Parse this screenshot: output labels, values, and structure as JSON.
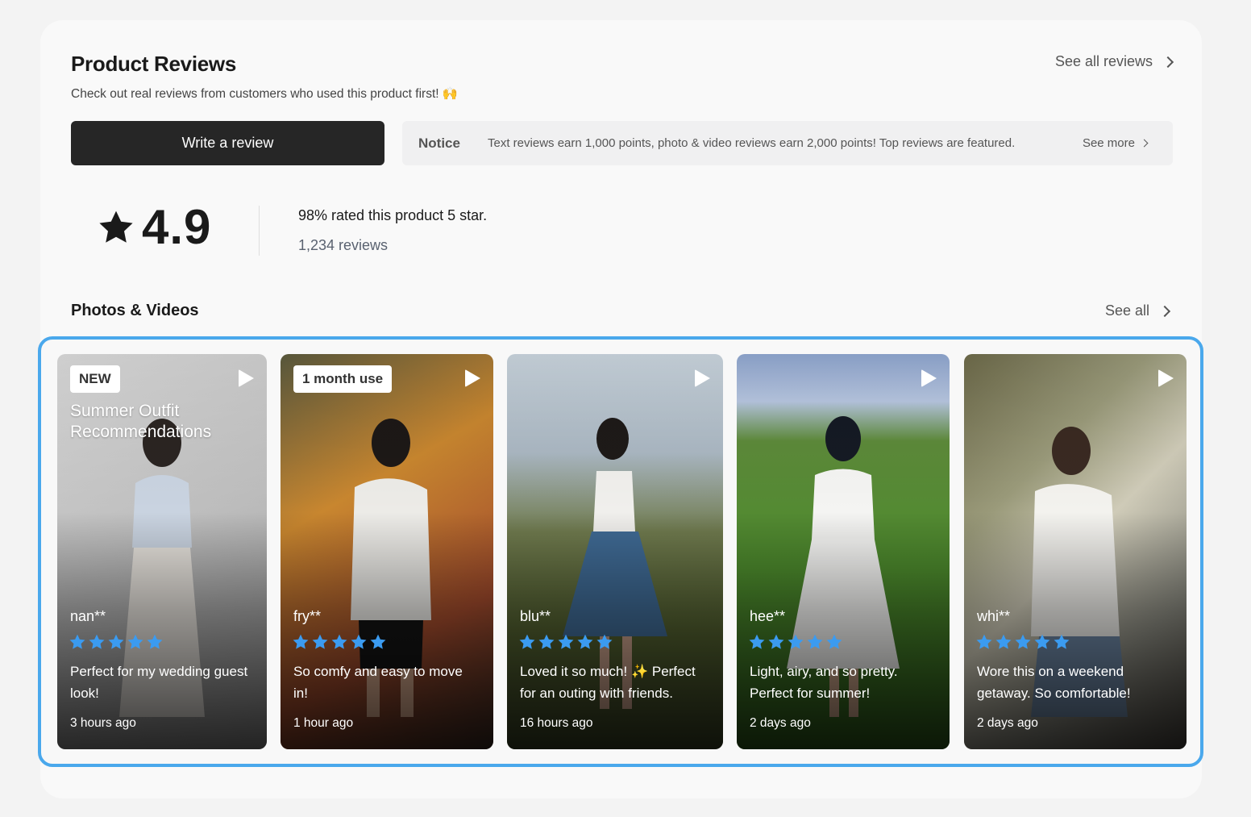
{
  "header": {
    "title": "Product Reviews",
    "subtitle": "Check out real reviews from customers who used this product first! 🙌",
    "see_all_label": "See all reviews"
  },
  "actions": {
    "write_review_label": "Write a review"
  },
  "notice": {
    "label": "Notice",
    "text": "Text reviews earn 1,000 points, photo & video reviews earn 2,000 points! Top reviews are featured.",
    "see_more_label": "See more"
  },
  "summary": {
    "rating": "4.9",
    "rated_text": "98% rated this product 5 star.",
    "review_count": "1,234 reviews"
  },
  "media_section": {
    "title": "Photos & Videos",
    "see_all_label": "See all"
  },
  "colors": {
    "accent": "#4aa8ec",
    "star": "#3b9bf0",
    "button_dark": "#262626"
  },
  "cards": [
    {
      "badge": "NEW",
      "overlay_title": "Summer Outfit Recommendations",
      "user": "nan**",
      "rating": 5,
      "comment": "Perfect for my wedding guest look!",
      "time": "3 hours ago"
    },
    {
      "badge": "1 month use",
      "overlay_title": "",
      "user": "fry**",
      "rating": 5,
      "comment": "So comfy and easy to move in!",
      "time": "1 hour ago"
    },
    {
      "badge": "",
      "overlay_title": "",
      "user": "blu**",
      "rating": 5,
      "comment": "Loved it so much! ✨ Perfect for an outing with friends.",
      "time": "16 hours ago"
    },
    {
      "badge": "",
      "overlay_title": "",
      "user": "hee**",
      "rating": 5,
      "comment": "Light, airy, and so pretty. Perfect for summer!",
      "time": "2 days ago"
    },
    {
      "badge": "",
      "overlay_title": "",
      "user": "whi**",
      "rating": 5,
      "comment": "Wore this on a weekend getaway. So comfortable!",
      "time": "2 days ago"
    }
  ]
}
